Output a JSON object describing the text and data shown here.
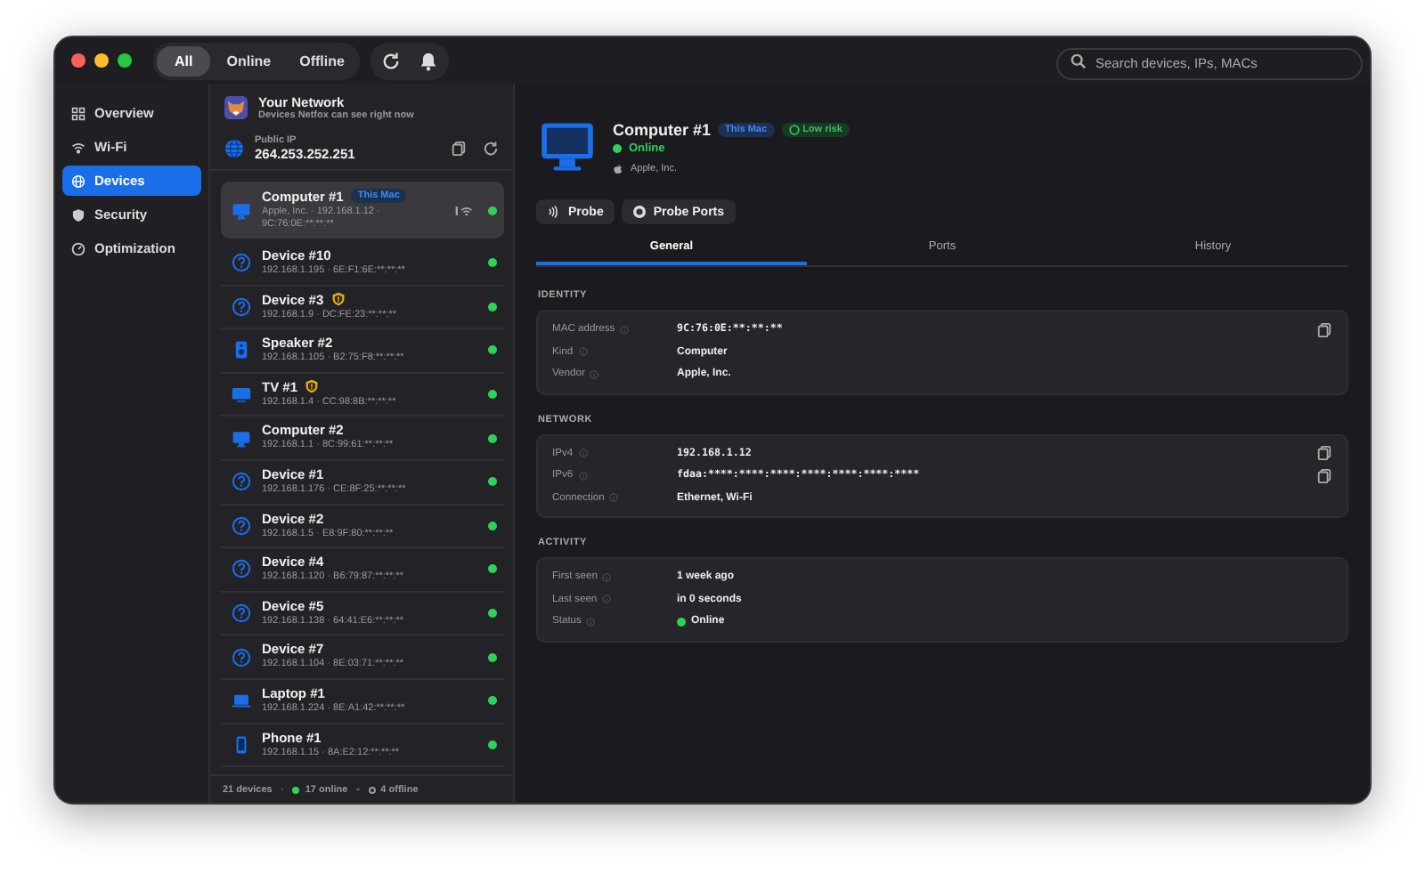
{
  "filters": [
    {
      "label": "All",
      "selected": true
    },
    {
      "label": "Online",
      "selected": false
    },
    {
      "label": "Offline",
      "selected": false
    }
  ],
  "search": {
    "placeholder": "Search devices, IPs, MACs"
  },
  "sidebar": {
    "items": [
      {
        "label": "Overview",
        "selected": false
      },
      {
        "label": "Wi-Fi",
        "selected": false
      },
      {
        "label": "Devices",
        "selected": true
      },
      {
        "label": "Security",
        "selected": false
      },
      {
        "label": "Optimization",
        "selected": false
      }
    ]
  },
  "network": {
    "title": "Your Network",
    "subtitle": "Devices Netfox can see right now",
    "public_ip_label": "Public IP",
    "public_ip": "264.253.252.251"
  },
  "devices": [
    {
      "name": "Computer #1",
      "kind": "computer",
      "badge": "This Mac",
      "details": "Apple, Inc. · 192.168.1.12 · 9C:76:0E:**:**:**",
      "warning": false,
      "connection_icons": true,
      "online": true,
      "selected": true
    },
    {
      "name": "Device #10",
      "kind": "unknown",
      "details": "192.168.1.195 · 6E:F1:6E:**:**:**",
      "warning": false,
      "connection_icons": false,
      "online": true,
      "selected": false
    },
    {
      "name": "Device #3",
      "kind": "unknown",
      "details": "192.168.1.9 · DC:FE:23:**:**:**",
      "warning": true,
      "connection_icons": false,
      "online": true,
      "selected": false
    },
    {
      "name": "Speaker #2",
      "kind": "speaker",
      "details": "192.168.1.105 · B2:75:F8:**:**:**",
      "warning": false,
      "connection_icons": false,
      "online": true,
      "selected": false
    },
    {
      "name": "TV #1",
      "kind": "tv",
      "details": "192.168.1.4 · CC:98:8B:**:**:**",
      "warning": true,
      "connection_icons": false,
      "online": true,
      "selected": false
    },
    {
      "name": "Computer #2",
      "kind": "computer",
      "details": "192.168.1.1 · 8C:99:61:**:**:**",
      "warning": false,
      "connection_icons": false,
      "online": true,
      "selected": false
    },
    {
      "name": "Device #1",
      "kind": "unknown",
      "details": "192.168.1.176 · CE:8F:25:**:**:**",
      "warning": false,
      "connection_icons": false,
      "online": true,
      "selected": false
    },
    {
      "name": "Device #2",
      "kind": "unknown",
      "details": "192.168.1.5 · E8:9F:80:**:**:**",
      "warning": false,
      "connection_icons": false,
      "online": true,
      "selected": false
    },
    {
      "name": "Device #4",
      "kind": "unknown",
      "details": "192.168.1.120 · B6:79:87:**:**:**",
      "warning": false,
      "connection_icons": false,
      "online": true,
      "selected": false
    },
    {
      "name": "Device #5",
      "kind": "unknown",
      "details": "192.168.1.138 · 64:41:E6:**:**:**",
      "warning": false,
      "connection_icons": false,
      "online": true,
      "selected": false
    },
    {
      "name": "Device #7",
      "kind": "unknown",
      "details": "192.168.1.104 · 8E:03:71:**:**:**",
      "warning": false,
      "connection_icons": false,
      "online": true,
      "selected": false
    },
    {
      "name": "Laptop #1",
      "kind": "laptop",
      "details": "192.168.1.224 · 8E:A1:42:**:**:**",
      "warning": false,
      "connection_icons": false,
      "online": true,
      "selected": false
    },
    {
      "name": "Phone #1",
      "kind": "phone",
      "details": "192.168.1.15 · 8A:E2:12:**:**:**",
      "warning": false,
      "connection_icons": false,
      "online": true,
      "selected": false
    }
  ],
  "footer": {
    "total": "21 devices",
    "online": "17 online",
    "offline": "4 offline"
  },
  "detail": {
    "name": "Computer #1",
    "kind": "computer",
    "badge": "This Mac",
    "risk": "Low risk",
    "status": "Online",
    "vendor": "Apple, Inc.",
    "actions": [
      "Probe",
      "Probe Ports"
    ],
    "tabs": [
      {
        "label": "General",
        "selected": true
      },
      {
        "label": "Ports",
        "selected": false
      },
      {
        "label": "History",
        "selected": false
      }
    ],
    "sections": [
      {
        "title": "IDENTITY",
        "rows": [
          {
            "label": "MAC address",
            "value": "9C:76:0E:**:**:**",
            "kind": "mono",
            "copy": true
          },
          {
            "label": "Kind",
            "value": "Computer",
            "kind": "text"
          },
          {
            "label": "Vendor",
            "value": "Apple, Inc.",
            "kind": "text"
          }
        ]
      },
      {
        "title": "NETWORK",
        "rows": [
          {
            "label": "IPv4",
            "value": "192.168.1.12",
            "kind": "mono",
            "copy": true
          },
          {
            "label": "IPv6",
            "value": "fdaa:****:****:****:****:****:****:****",
            "kind": "mono",
            "copy": true
          },
          {
            "label": "Connection",
            "value": "Ethernet, Wi-Fi",
            "kind": "text"
          }
        ]
      },
      {
        "title": "ACTIVITY",
        "rows": [
          {
            "label": "First seen",
            "value": "1 week ago",
            "kind": "text"
          },
          {
            "label": "Last seen",
            "value": "in 0 seconds",
            "kind": "text"
          },
          {
            "label": "Status",
            "value": "Online",
            "kind": "status"
          }
        ]
      }
    ]
  }
}
